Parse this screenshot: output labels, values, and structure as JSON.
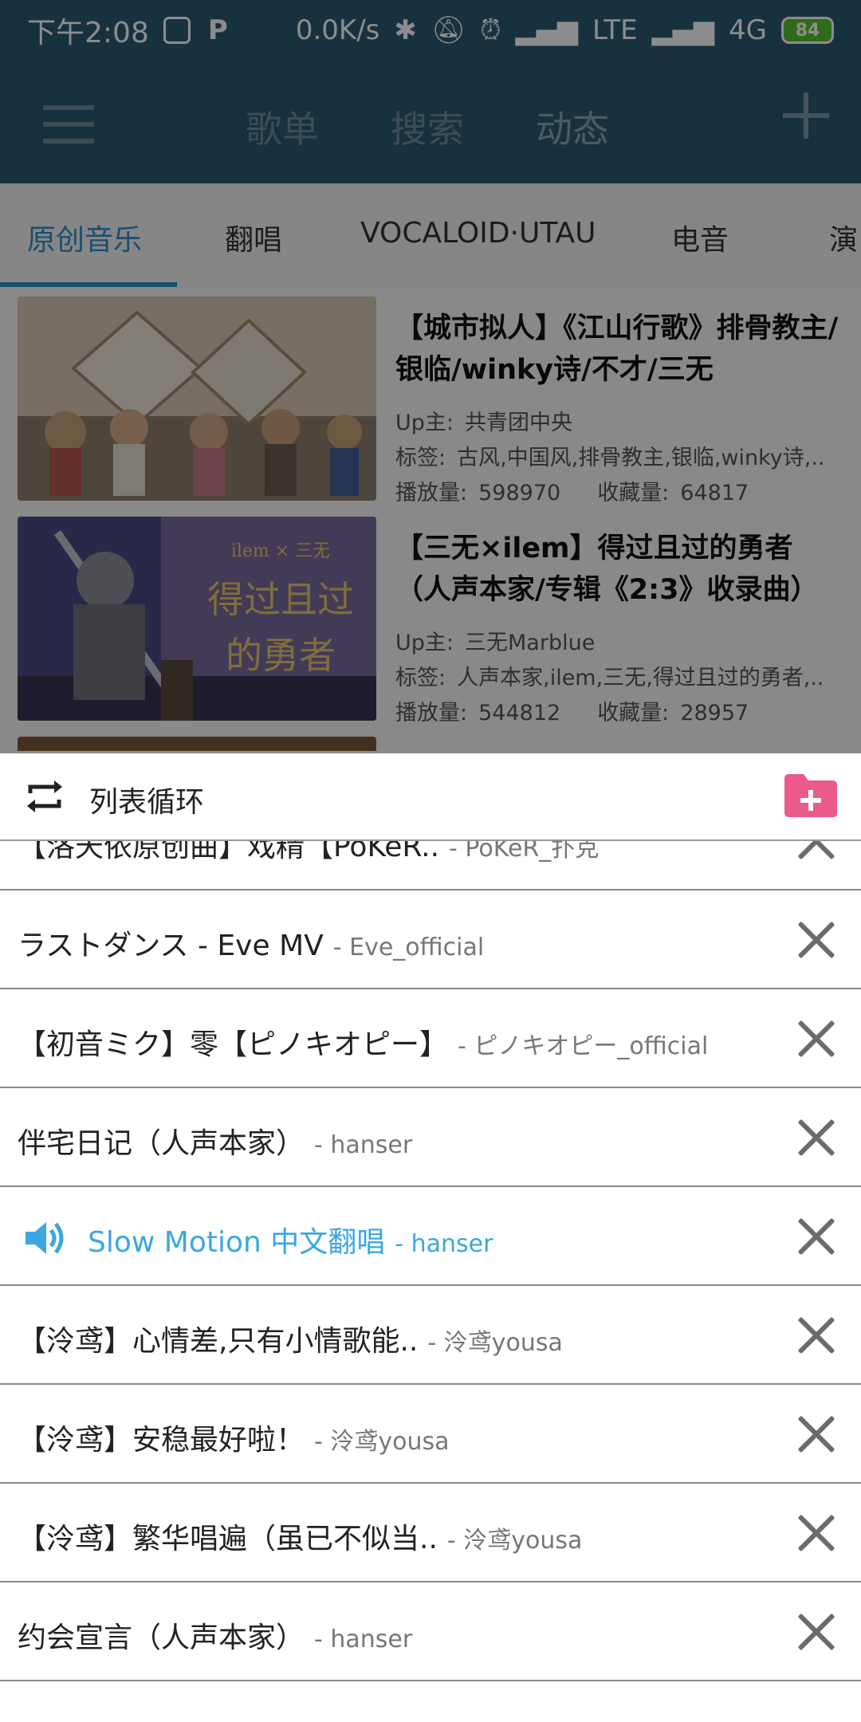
{
  "status_bar": {
    "time": "下午2:08",
    "p_icon": "P",
    "speed": "0.0K/s",
    "network": "LTE",
    "network2": "4G",
    "battery": "84",
    "battery_color": "#57c22e"
  },
  "app_bar": {
    "tabs": [
      "歌单",
      "搜索",
      "动态"
    ],
    "active_tab": "动态"
  },
  "categories": {
    "tabs": [
      "原创音乐",
      "翻唱",
      "VOCALOID·UTAU",
      "电音",
      "演"
    ],
    "active": "原创音乐"
  },
  "cards": [
    {
      "title": "【城市拟人】《江山行歌》排骨教主/银临/winky诗/不才/三无",
      "up_label": "Up主:",
      "up": "共青团中央",
      "tags_label": "标签:",
      "tags": "古风,中国风,排骨教主,银临,winky诗,..",
      "plays_label": "播放量:",
      "plays": "598970",
      "favs_label": "收藏量:",
      "favs": "64817"
    },
    {
      "title": "【三无×ilem】得过且过的勇者（人声本家/专辑《2:3》收录曲）",
      "up_label": "Up主:",
      "up": "三无Marblue",
      "tags_label": "标签:",
      "tags": "人声本家,ilem,三无,得过且过的勇者,..",
      "plays_label": "播放量:",
      "plays": "544812",
      "favs_label": "收藏量:",
      "favs": "28957"
    }
  ],
  "sheet": {
    "mode_label": "列表循环",
    "accent": "#3aa6e2",
    "playlist": [
      {
        "title": "【洛天依原创曲】戏精【PoKeR..",
        "artist": "- PoKeR_扑克"
      },
      {
        "title": "ラストダンス - Eve MV",
        "artist": "- Eve_official"
      },
      {
        "title": "【初音ミク】零【ピノキオピー】",
        "artist": "- ピノキオピー_official"
      },
      {
        "title": "伴宅日记（人声本家）",
        "artist": "- hanser"
      },
      {
        "title": "Slow Motion 中文翻唱",
        "artist": "- hanser",
        "playing": true
      },
      {
        "title": "【泠鸢】心情差,只有小情歌能..",
        "artist": "- 泠鸢yousa"
      },
      {
        "title": "【泠鸢】安稳最好啦！",
        "artist": "- 泠鸢yousa"
      },
      {
        "title": "【泠鸢】繁华唱遍（虽已不似当..",
        "artist": "- 泠鸢yousa"
      },
      {
        "title": "约会宣言（人声本家）",
        "artist": "- hanser"
      }
    ]
  }
}
